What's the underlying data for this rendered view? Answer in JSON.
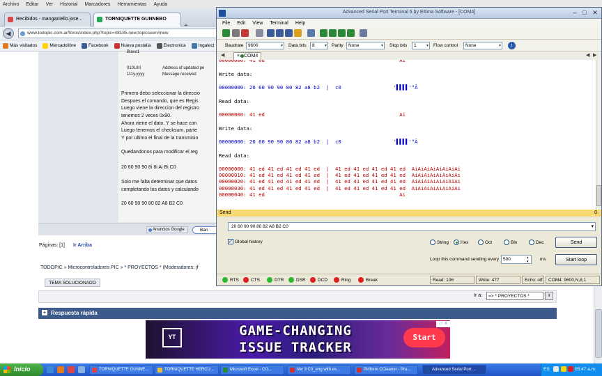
{
  "browser": {
    "menu": [
      "Archivo",
      "Editar",
      "Ver",
      "Historial",
      "Marcadores",
      "Herramientas",
      "Ayuda"
    ],
    "tabs": [
      {
        "label": "Recibidos - manganiello.jose...",
        "color": "#d44"
      },
      {
        "label": "TORNIQUETTE GUNNEBO",
        "color": "#2a5"
      }
    ],
    "url": "www.todopic.com.ar/foros/index.php?topic=48185.new;topicseen#new",
    "bookmarks": [
      {
        "label": "Más visitados",
        "color": "#e07a20"
      },
      {
        "label": "Mercadolibre",
        "color": "#ffd400"
      },
      {
        "label": "Facebook",
        "color": "#3b5998"
      },
      {
        "label": "Nueva postalia",
        "color": "#c33"
      },
      {
        "label": "Electronica",
        "color": "#555"
      },
      {
        "label": "Ingalect",
        "color": "#47a"
      }
    ]
  },
  "forum": {
    "table_rows": [
      {
        "c1": "",
        "c2": "Blavo1"
      },
      {
        "c1": "010LIIII",
        "c2": "Address of updated pe"
      },
      {
        "c1": "111y.yyyy",
        "c2": "Message received"
      }
    ],
    "post_lines": [
      "Primero debo seleccionar la direccio",
      "Despues el comando, que es Regis",
      "Luego viene la direccion del registro",
      "tenemos 2 veces 0x90.",
      "Ahora viene el dato. Y se hace con",
      "Luego tenemos el checksum, parte",
      "Y por ultimo el final de la transmisio"
    ],
    "post_line_2": "Quedandonos para modificar el reg",
    "post_line_3": "20 60 90 90 8i 8i Ai Bi C0",
    "post_line_4": "Solo me falta determinar que datos",
    "post_line_5": "completando los datos y calculando",
    "post_line_6": "20 60 90 90 80 82 A8 B2 C0",
    "thanks_label": "Anuncios Google",
    "quote_label": "Ban",
    "pages_label": "Páginas: [1]",
    "go_up": "Ir Arriba",
    "breadcrumb": "TODOPIC » Microcontroladores PIC » * PROYECTOS * (Moderadores: jf",
    "solved_label": "TEMA SOLUCIONADO",
    "jump_label": "Ir a:",
    "jump_value": "=> * PROYECTOS *",
    "jump_go": "ir",
    "quick_reply": "Respuesta rápida"
  },
  "ad": {
    "logo": "YT",
    "line1": "GAME-CHANGING",
    "line2": "ISSUE TRACKER",
    "cta": "Start",
    "close": "ⓘ X"
  },
  "aspt": {
    "title": "Advanced Serial Port Terminal 6 by Eltima Software - [COM4]",
    "menu": [
      "File",
      "Edit",
      "View",
      "Terminal",
      "Help"
    ],
    "settings": {
      "baudrate_label": "Baudrate",
      "baudrate": "9600",
      "databits_label": "Data bits",
      "databits": "8",
      "parity_label": "Parity",
      "parity": "None",
      "stopbits_label": "Stop bits",
      "stopbits": "1",
      "flow_label": "Flow control",
      "flow": "None"
    },
    "tab_label": "COM4",
    "terminal": [
      {
        "type": "r",
        "text": "00000000: 41 ed                                            Ai"
      },
      {
        "type": "hdr",
        "text": "Write data:"
      },
      {
        "type": "w",
        "text": "00000000: 20 60 90 90 80 82 a8 b2  |  c0                 '▌▌▌▌'°Â"
      },
      {
        "type": "hdr",
        "text": "Read data:"
      },
      {
        "type": "r",
        "text": "00000000: 41 ed                                            Ai"
      },
      {
        "type": "hdr",
        "text": "Write data:"
      },
      {
        "type": "w",
        "text": "00000000: 20 60 90 90 80 82 a8 b2  |  c0                 '▌▌▌▌'°Â"
      },
      {
        "type": "hdr",
        "text": "Read data:"
      },
      {
        "type": "r",
        "text": "00000000: 41 ed 41 ed 41 ed 41 ed  |  41 ed 41 ed 41 ed 41 ed  AiAiAiAiAiAiAiAi"
      },
      {
        "type": "r",
        "text": "00000010: 41 ed 41 ed 41 ed 41 ed  |  41 ed 41 ed 41 ed 41 ed  AiAiAiAiAiAiAiAi"
      },
      {
        "type": "r",
        "text": "00000020: 41 ed 41 ed 41 ed 41 ed  |  41 ed 41 ed 41 ed 41 ed  AiAiAiAiAiAiAiAi"
      },
      {
        "type": "r",
        "text": "00000030: 41 ed 41 ed 41 ed 41 ed  |  41 ed 41 ed 41 ed 41 ed  AiAiAiAiAiAiAiAi"
      },
      {
        "type": "r",
        "text": "00000040: 41 ed                                            Ai"
      }
    ],
    "send_label": "Send",
    "send_pin": "0.",
    "send_value": "20 60 90 90 80 82 A8 B2 C0",
    "global_history": "Global history",
    "formats": [
      {
        "label": "String",
        "selected": false
      },
      {
        "label": "Hex",
        "selected": true
      },
      {
        "label": "Oct",
        "selected": false
      },
      {
        "label": "Bin",
        "selected": false
      },
      {
        "label": "Dec",
        "selected": false
      }
    ],
    "send_button": "Send",
    "loop_label": "Loop this command sending every",
    "loop_ms": "500",
    "loop_unit": "ms",
    "start_loop": "Start loop",
    "signals": [
      {
        "label": "RTS",
        "color": "#2eb82e"
      },
      {
        "label": "CTS",
        "color": "#e02020"
      },
      {
        "label": "DTR",
        "color": "#2eb82e"
      },
      {
        "label": "DSR",
        "color": "#2eb82e"
      },
      {
        "label": "DCD",
        "color": "#e02020"
      },
      {
        "label": "Ring",
        "color": "#e02020"
      },
      {
        "label": "Break",
        "color": "#e02020"
      }
    ],
    "read": "Read: 106",
    "write": "Write: 477",
    "echo": "Echo: off",
    "port": "COM4: 9600,N,8,1"
  },
  "taskbar": {
    "start": "Inicio",
    "tasks": [
      {
        "label": "TORNIQUETTE GUNNE...",
        "color": "#d44"
      },
      {
        "label": "TORNIQUETTE HERCU...",
        "color": "#e8c040"
      },
      {
        "label": "Microsoft Excel - CG...",
        "color": "#2a8a3a"
      },
      {
        "label": "Ver 3 C0_eng with es...",
        "color": "#c33"
      },
      {
        "label": "Piriform CCleaner - Pro...",
        "color": "#c33"
      },
      {
        "label": "Advanced Serial Port ...",
        "color": "#1d4f9a"
      }
    ],
    "lang": "ES",
    "clock": "05:47 a.m."
  }
}
